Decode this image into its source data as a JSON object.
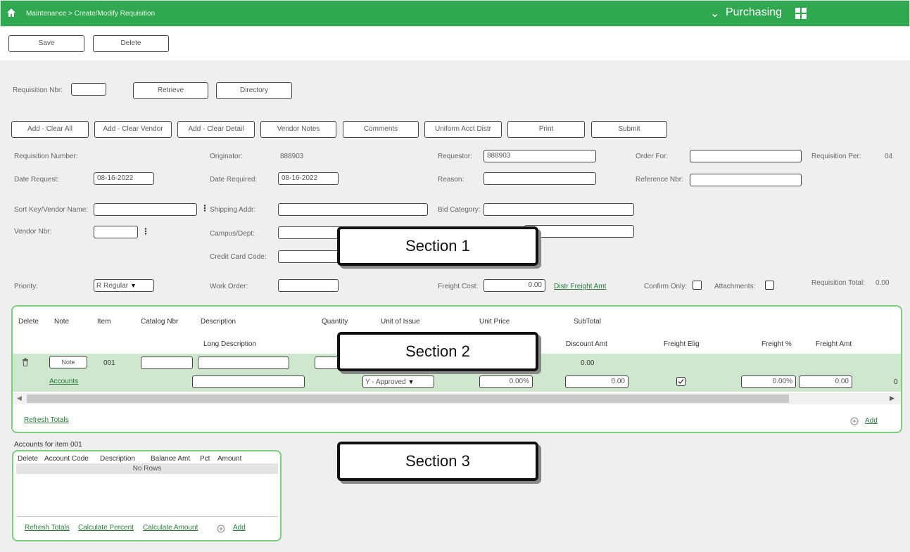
{
  "topbar": {
    "breadcrumb": "Maintenance > Create/Modify Requisition",
    "module": "Purchasing",
    "chevron": "⌄"
  },
  "toolbar": {
    "save_label": "Save",
    "delete_label": "Delete"
  },
  "retrieve": {
    "req_nbr_label": "Requisition Nbr:",
    "req_nbr_value": "",
    "retrieve_label": "Retrieve",
    "directory_label": "Directory"
  },
  "actions": {
    "add_clear_all": "Add - Clear All",
    "add_clear_vendor": "Add - Clear Vendor",
    "add_clear_detail": "Add - Clear Detail",
    "vendor_notes": "Vendor Notes",
    "comments": "Comments",
    "uniform_acct_distr": "Uniform Acct Distr",
    "print": "Print",
    "submit": "Submit"
  },
  "form": {
    "requisition_number_label": "Requisition Number:",
    "originator_label": "Originator:",
    "originator_value": "888903",
    "requestor_label": "Requestor:",
    "requestor_value": "888903",
    "order_for_label": "Order For:",
    "order_for_value": "",
    "requisition_per_label": "Requisition Per:",
    "requisition_per_value": "04",
    "date_request_label": "Date Request:",
    "date_request_value": "08-16-2022",
    "date_required_label": "Date Required:",
    "date_required_value": "08-16-2022",
    "reason_label": "Reason:",
    "reason_value": "",
    "reference_nbr_label": "Reference Nbr:",
    "reference_nbr_value": "",
    "sort_key_label": "Sort Key/Vendor Name:",
    "sort_key_value": "",
    "shipping_addr_label": "Shipping Addr:",
    "shipping_addr_value": "",
    "bid_category_label": "Bid Category:",
    "bid_category_value": "",
    "vendor_nbr_label": "Vendor Nbr:",
    "vendor_nbr_value": "",
    "campus_dept_label": "Campus/Dept:",
    "campus_dept_value": "",
    "credit_card_code_label": "Credit Card Code:",
    "credit_card_code_value": "",
    "priority_label": "Priority:",
    "priority_value": "R Regular",
    "work_order_label": "Work Order:",
    "work_order_value": "",
    "freight_cost_label": "Freight Cost:",
    "freight_cost_value": "0.00",
    "distr_freight_amt": "Distr Freight Amt",
    "confirm_only_label": "Confirm Only:",
    "attachments_label": "Attachments:",
    "requisition_total_label": "Requisition Total:",
    "requisition_total_value": "0.00"
  },
  "items": {
    "headers": {
      "delete": "Delete",
      "note": "Note",
      "item": "Item",
      "catalog_nbr": "Catalog Nbr",
      "description": "Description",
      "quantity": "Quantity",
      "unit_of_issue": "Unit of Issue",
      "unit_price": "Unit Price",
      "subtotal": "SubTotal",
      "long_description": "Long Description",
      "discount_amt": "Discount Amt",
      "freight_elig": "Freight Elig",
      "freight_pct": "Freight %",
      "freight_amt": "Freight Amt"
    },
    "row": {
      "note_label": "Note",
      "item": "001",
      "subtotal": "0.00",
      "accounts_link": "Accounts",
      "approval_value": "Y - Approved",
      "pct_value": "0.00%",
      "discount_value": "0.00",
      "freight_elig_checked": true,
      "freight_pct_value": "0.00%",
      "freight_amt_value": "0.00",
      "trailing_value": "0"
    },
    "refresh_totals": "Refresh Totals",
    "add": "Add"
  },
  "accounts": {
    "title": "Accounts for item 001",
    "headers": {
      "delete": "Delete",
      "account_code": "Account Code",
      "description": "Description",
      "balance_amt": "Balance Amt",
      "pct": "Pct",
      "amount": "Amount"
    },
    "no_rows": "No Rows",
    "refresh_totals": "Refresh Totals",
    "calculate_percent": "Calculate Percent",
    "calculate_amount": "Calculate Amount",
    "add": "Add"
  },
  "callouts": {
    "section1": "Section 1",
    "section2": "Section 2",
    "section3": "Section 3"
  },
  "colors": {
    "brand_green": "#2fa84f",
    "panel_border": "#7ccf7c",
    "row_green": "#cfe6cf",
    "link_green": "#2a7a3a"
  },
  "icons": [
    "home-icon",
    "chevron-down-icon",
    "grid-icon",
    "kebab-menu-icon",
    "trash-icon",
    "checkbox-checked-icon",
    "add-circle-icon",
    "scroll-left-icon",
    "scroll-right-icon",
    "dropdown-arrow-icon"
  ]
}
